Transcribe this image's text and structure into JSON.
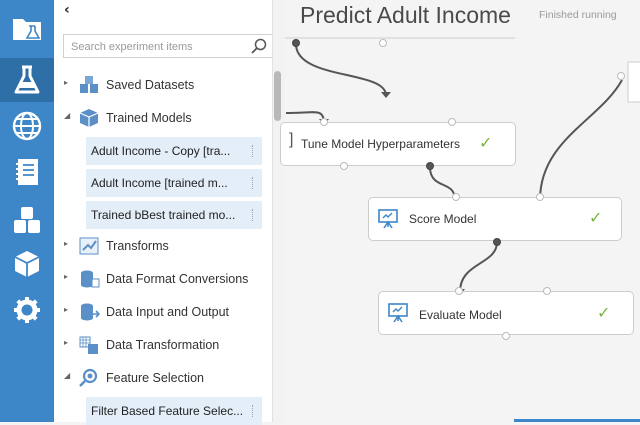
{
  "colors": {
    "rail": "#3d86c7",
    "rail_active": "#2f6fa8",
    "selected_item_bg": "#e3eef8",
    "check": "#7bb342"
  },
  "rail": {
    "items": [
      {
        "name": "projects-icon"
      },
      {
        "name": "experiments-icon",
        "active": true
      },
      {
        "name": "web-services-icon"
      },
      {
        "name": "notebooks-icon"
      },
      {
        "name": "datasets-icon"
      },
      {
        "name": "trained-models-icon"
      },
      {
        "name": "settings-icon"
      }
    ]
  },
  "palette": {
    "collapse_glyph": "‹",
    "search": {
      "placeholder": "Search experiment items",
      "value": ""
    },
    "categories": [
      {
        "label": "Saved Datasets",
        "expanded": false
      },
      {
        "label": "Trained Models",
        "expanded": true,
        "items": [
          "Adult Income - Copy [tra...",
          "Adult Income [trained m...",
          "Trained bBest trained mo..."
        ]
      },
      {
        "label": "Transforms",
        "expanded": false
      },
      {
        "label": "Data Format Conversions",
        "expanded": false
      },
      {
        "label": "Data Input and Output",
        "expanded": false
      },
      {
        "label": "Data Transformation",
        "expanded": false
      },
      {
        "label": "Feature Selection",
        "expanded": true,
        "items": [
          "Filter Based Feature Selec..."
        ]
      }
    ]
  },
  "canvas": {
    "title": "Predict Adult Income",
    "status": "Finished running",
    "nodes": [
      {
        "label": "Tune Model Hyperparameters",
        "status": "completed"
      },
      {
        "label": "Score Model",
        "status": "completed"
      },
      {
        "label": "Evaluate Model",
        "status": "completed"
      }
    ]
  }
}
